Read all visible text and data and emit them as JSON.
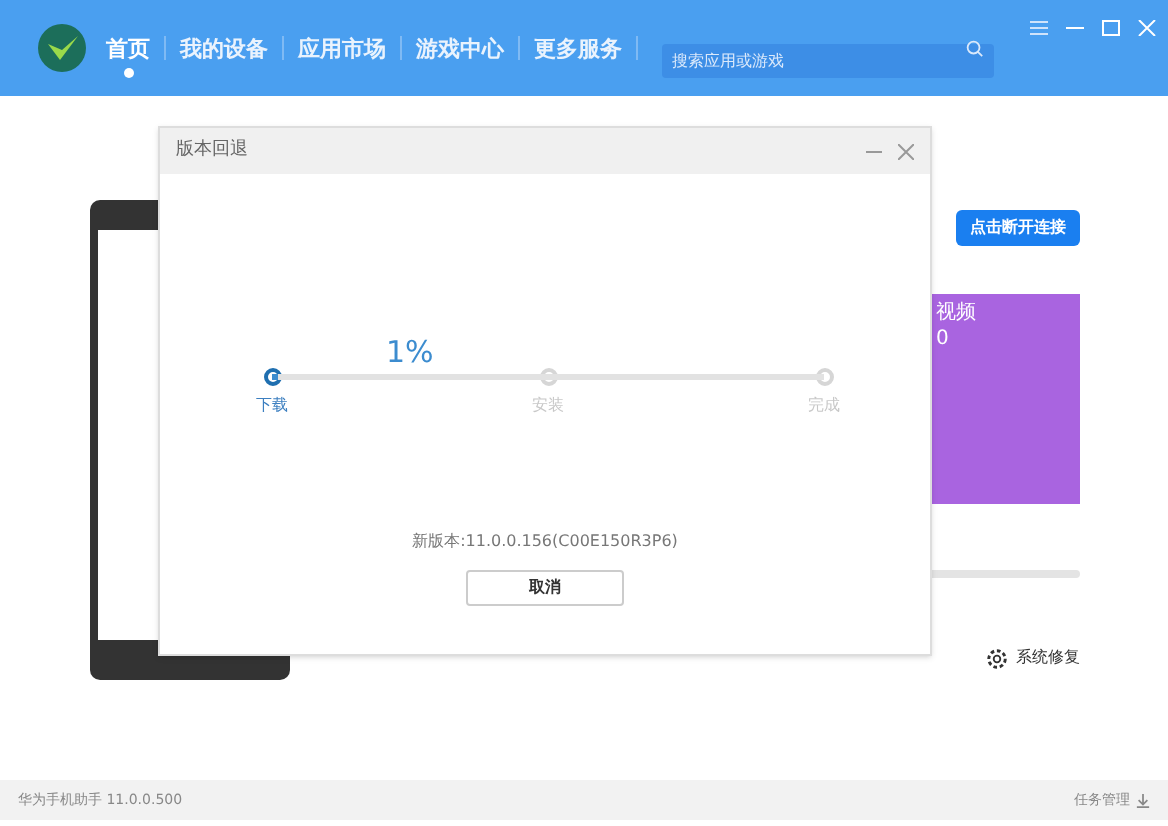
{
  "header": {
    "nav": [
      {
        "label": "首页",
        "selected": true
      },
      {
        "label": "我的设备",
        "selected": false
      },
      {
        "label": "应用市场",
        "selected": false
      },
      {
        "label": "游戏中心",
        "selected": false
      },
      {
        "label": "更多服务",
        "selected": false
      }
    ],
    "search": {
      "placeholder": "搜索应用或游戏"
    }
  },
  "main": {
    "disconnect_button": "点击断开连接",
    "video_card": {
      "title": "视频",
      "count": "0"
    },
    "repair_link": "系统修复"
  },
  "dialog": {
    "title": "版本回退",
    "progress": {
      "label": "1%",
      "level": 0.01
    },
    "steps": [
      {
        "label": "下载",
        "selected": true
      },
      {
        "label": "安装",
        "selected": false
      },
      {
        "label": "完成",
        "selected": false
      }
    ],
    "version": "新版本:11.0.0.156(C00E150R3P6)",
    "cancel_button": "取消"
  },
  "status_bar": {
    "app_version": "华为手机助手 11.0.0.500",
    "task_manager": "任务管理"
  }
}
